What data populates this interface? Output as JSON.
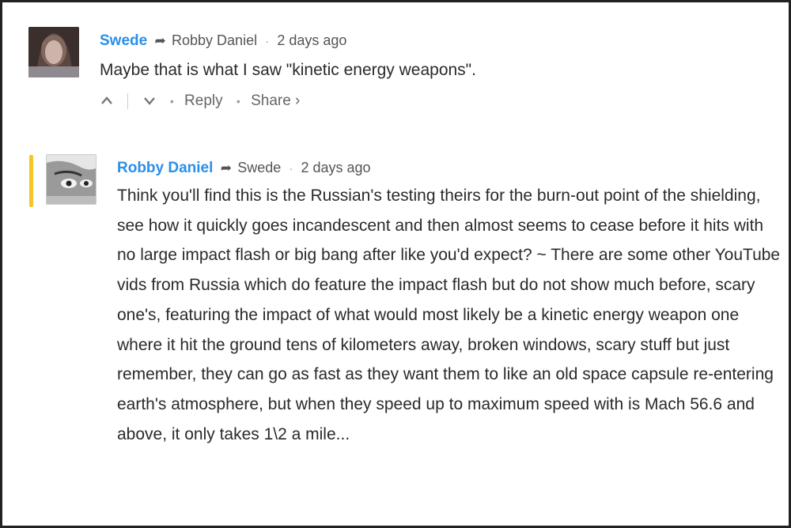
{
  "comments": [
    {
      "author": "Swede",
      "reply_to": "Robby Daniel",
      "separator": "·",
      "time": "2 days ago",
      "text": "Maybe that is what I saw \"kinetic energy weapons\".",
      "actions": {
        "upvote_icon": "chevron-up",
        "downvote_icon": "chevron-down",
        "reply_label": "Reply",
        "share_label": "Share ›"
      }
    },
    {
      "author": "Robby Daniel",
      "reply_to": "Swede",
      "separator": "·",
      "time": "2 days ago",
      "text": "Think you'll find this is the Russian's testing theirs for the burn-out point of the shielding, see how it quickly goes incandescent and then almost seems to cease before it hits with no large impact flash or big bang after like you'd expect? ~ There are some other YouTube vids from Russia which do feature the impact flash but do not show much before, scary one's, featuring the impact of what would most likely be a kinetic energy weapon one where it hit the ground tens of kilometers away, broken windows, scary stuff but just remember, they can go as fast as they want them to like an old space capsule re-entering earth's atmosphere, but when they speed up to maximum speed with is Mach 56.6 and above, it only takes 1\\2 a mile..."
    }
  ],
  "colors": {
    "author": "#2a8fe8",
    "highlight": "#f7c325",
    "text": "#2a2a2a",
    "meta": "#555555"
  }
}
